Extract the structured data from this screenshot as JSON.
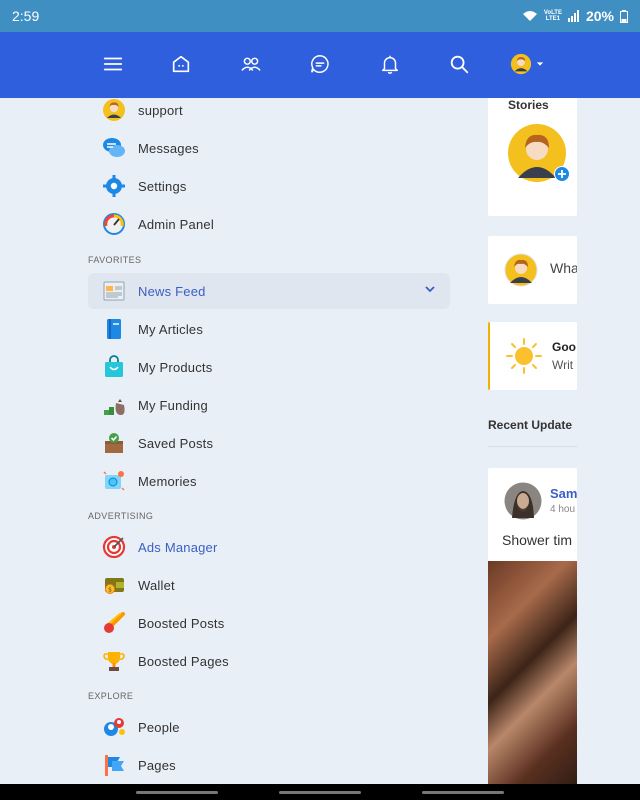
{
  "status": {
    "time": "2:59",
    "battery": "20%",
    "network_top": "VoLTE",
    "network_bottom": "LTE1"
  },
  "nav": {
    "icons": [
      "menu-icon",
      "home-icon",
      "friends-icon",
      "chat-icon",
      "bell-icon",
      "search-icon",
      "avatar-dropdown"
    ]
  },
  "sidebar": {
    "items_top": [
      {
        "label": "support",
        "icon": "avatar-icon"
      },
      {
        "label": "Messages",
        "icon": "messages-icon"
      },
      {
        "label": "Settings",
        "icon": "gear-icon"
      },
      {
        "label": "Admin Panel",
        "icon": "speedometer-icon"
      }
    ],
    "sections": {
      "favorites": "FAVORITES",
      "advertising": "ADVERTISING",
      "explore": "EXPLORE"
    },
    "favorites": [
      {
        "label": "News Feed",
        "icon": "newspaper-icon"
      },
      {
        "label": "My Articles",
        "icon": "notebook-icon"
      },
      {
        "label": "My Products",
        "icon": "shopping-bag-icon"
      },
      {
        "label": "My Funding",
        "icon": "money-bag-icon"
      },
      {
        "label": "Saved Posts",
        "icon": "box-check-icon"
      },
      {
        "label": "Memories",
        "icon": "memories-icon"
      }
    ],
    "advertising": [
      {
        "label": "Ads Manager",
        "icon": "target-icon"
      },
      {
        "label": "Wallet",
        "icon": "wallet-icon"
      },
      {
        "label": "Boosted Posts",
        "icon": "comet-icon"
      },
      {
        "label": "Boosted Pages",
        "icon": "trophy-icon"
      }
    ],
    "explore": [
      {
        "label": "People",
        "icon": "people-icon"
      },
      {
        "label": "Pages",
        "icon": "flag-icon"
      }
    ]
  },
  "feed": {
    "stories_title": "Stories",
    "composer_placeholder": "Wha",
    "greeting_title": "Goo",
    "greeting_sub": "Writ",
    "recent_updates": "Recent Update",
    "post": {
      "author": "Sam",
      "time": "4 hou",
      "text": "Shower tim"
    }
  },
  "colors": {
    "nav": "#2f5fdc",
    "status": "#3f8fc2",
    "accent": "#3a5fc4",
    "background": "#e9eff6"
  }
}
